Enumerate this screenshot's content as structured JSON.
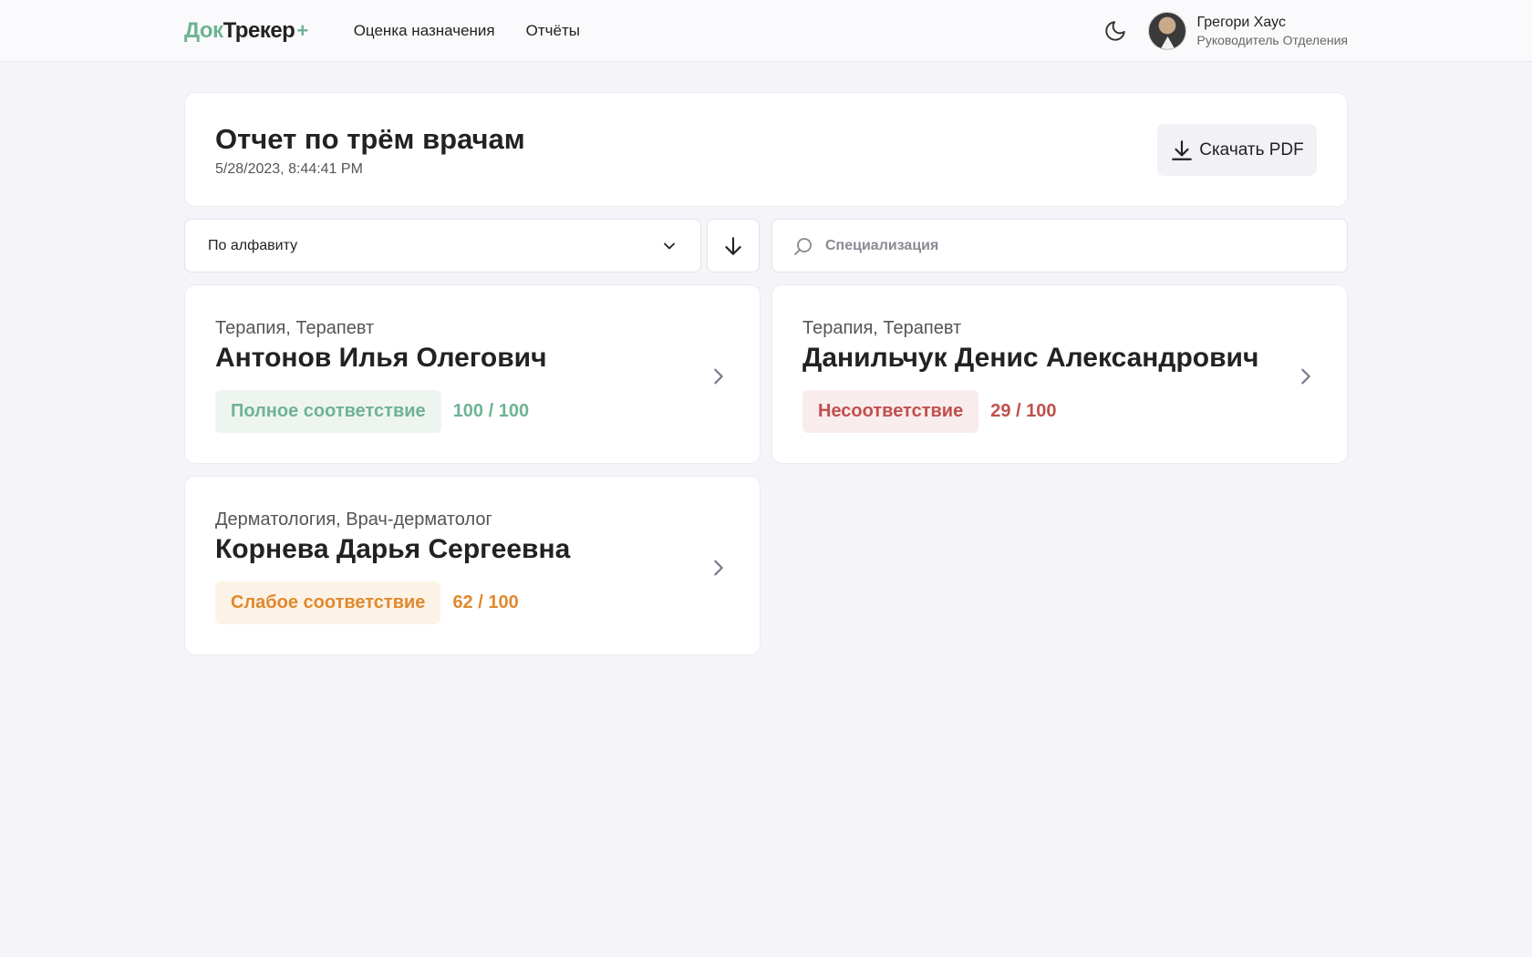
{
  "app": {
    "logo_part1": "Док",
    "logo_part2": "Трекер",
    "logo_plus": "+"
  },
  "nav": {
    "items": [
      {
        "label": "Оценка назначения"
      },
      {
        "label": "Отчёты"
      }
    ]
  },
  "user": {
    "name": "Грегори Хаус",
    "role": "Руководитель Отделения"
  },
  "report": {
    "title": "Отчет по трём врачам",
    "date": "5/28/2023, 8:44:41 PM",
    "download_label": "Скачать PDF"
  },
  "filters": {
    "sort_value": "По алфавиту",
    "search_placeholder": "Специализация"
  },
  "colors": {
    "brand_green": "#6fb394",
    "full_text": "#6fb394",
    "full_bg": "#eef5f1",
    "none_text": "#c0504d",
    "none_bg": "#f9ecec",
    "weak_text": "#e0892e",
    "weak_bg": "#fdf2e6"
  },
  "doctors": [
    {
      "specialization": "Терапия, Терапевт",
      "name": "Антонов Илья Олегович",
      "status": "Полное соответствие",
      "score": "100 / 100"
    },
    {
      "specialization": "Терапия, Терапевт",
      "name": "Данильчук Денис Александрович",
      "status": "Несоответствие",
      "score": "29 / 100"
    },
    {
      "specialization": "Дерматология, Врач-дерматолог",
      "name": "Корнева Дарья Сергеевна",
      "status": "Слабое соответствие",
      "score": "62 / 100"
    }
  ]
}
